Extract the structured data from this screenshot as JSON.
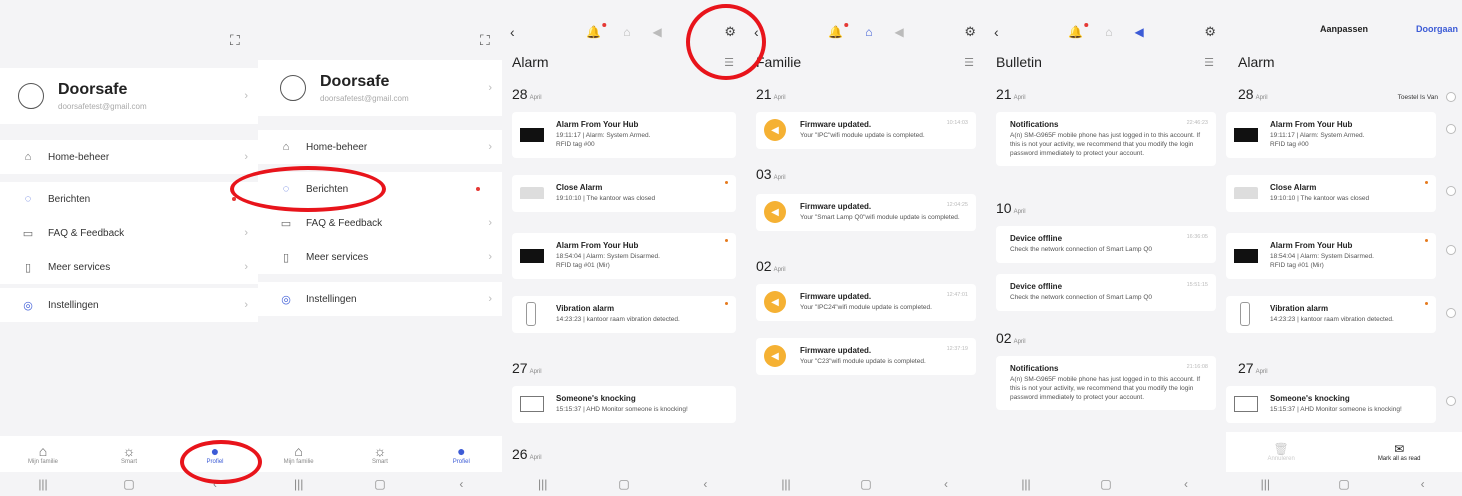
{
  "panel1": {
    "user_name": "Doorsafe",
    "user_email": "doorsafetest@gmail.com",
    "menu": [
      "Home-beheer",
      "Berichten",
      "FAQ & Feedback",
      "Meer services",
      "Instellingen"
    ],
    "tabs": [
      "Mijn familie",
      "Smart",
      "Profiel"
    ]
  },
  "panel2": {
    "user_name": "Doorsafe",
    "user_email": "doorsafetest@gmail.com",
    "menu": [
      "Home-beheer",
      "Berichten",
      "FAQ & Feedback",
      "Meer services",
      "Instellingen"
    ],
    "tabs": [
      "Mijn familie",
      "Smart",
      "Profiel"
    ]
  },
  "alarm": {
    "title": "Alarm",
    "date1": "28",
    "date1_month": "April",
    "cards": [
      {
        "title": "Alarm From Your Hub",
        "body": "19:11:17 | Alarm: System Armed.\nRFID tag #00"
      },
      {
        "title": "Close Alarm",
        "body": "19:10:10 | The kantoor was closed"
      },
      {
        "title": "Alarm From Your Hub",
        "body": "18:54:04 | Alarm: System Disarmed.\nRFID tag #01 (Mir)"
      },
      {
        "title": "Vibration alarm",
        "body": "14:23:23 | kantoor raam vibration detected."
      }
    ],
    "date2": "27",
    "date2_month": "April",
    "card5": {
      "title": "Someone's knocking",
      "body": "15:15:37 | AHD Monitor someone is knocking!"
    },
    "date3": "26",
    "date3_month": "April"
  },
  "familie": {
    "title": "Familie",
    "d1": "21",
    "d1m": "April",
    "c1": {
      "title": "Firmware updated.",
      "time": "10:14:03",
      "body": "Your \"IPC\"wifi module update is completed."
    },
    "d2": "03",
    "d2m": "April",
    "c2": {
      "title": "Firmware updated.",
      "time": "12:04:25",
      "body": "Your \"Smart Lamp Q0\"wifi module update is completed."
    },
    "d3": "02",
    "d3m": "April",
    "c3": {
      "title": "Firmware updated.",
      "time": "12:47:01",
      "body": "Your \"IPC24\"wifi module update is completed."
    },
    "c4": {
      "title": "Firmware updated.",
      "time": "12:37:19",
      "body": "Your \"C23\"wifi module update is completed."
    }
  },
  "bulletin": {
    "title": "Bulletin",
    "d1": "21",
    "d1m": "April",
    "c1": {
      "title": "Notifications",
      "time": "22:46:23",
      "body": "A(n) SM-G965F mobile phone has just logged in to this account. If this is not your activity, we recommend that you modify the login password immediately to protect your account."
    },
    "d2": "10",
    "d2m": "April",
    "c2": {
      "title": "Device offline",
      "time": "16:36:05",
      "body": "Check the network connection of Smart Lamp Q0"
    },
    "c3": {
      "title": "Device offline",
      "time": "15:51:15",
      "body": "Check the network connection of Smart Lamp Q0"
    },
    "d3": "02",
    "d3m": "April",
    "c4": {
      "title": "Notifications",
      "time": "21:16:08",
      "body": "A(n) SM-G965F mobile phone has just logged in to this account. If this is not your activity, we recommend that you modify the login password immediately to protect your account."
    }
  },
  "edit": {
    "header": "Aanpassen",
    "done": "Doorgaan",
    "title": "Alarm",
    "date1": "28",
    "date1_month": "April",
    "toestel": "Toestel Is Van",
    "cards": [
      {
        "title": "Alarm From Your Hub",
        "body": "19:11:17 | Alarm: System Armed.\nRFID tag #00"
      },
      {
        "title": "Close Alarm",
        "body": "19:10:10 | The kantoor was closed"
      },
      {
        "title": "Alarm From Your Hub",
        "body": "18:54:04 | Alarm: System Disarmed.\nRFID tag #01 (Mir)"
      },
      {
        "title": "Vibration alarm",
        "body": "14:23:23 | kantoor raam vibration detected."
      }
    ],
    "date2": "27",
    "date2_month": "April",
    "card5": {
      "title": "Someone's knocking",
      "body": "15:15:37 | AHD Monitor someone is knocking!"
    },
    "delete_label": "Annuleren",
    "mark_read": "Mark all as read"
  }
}
